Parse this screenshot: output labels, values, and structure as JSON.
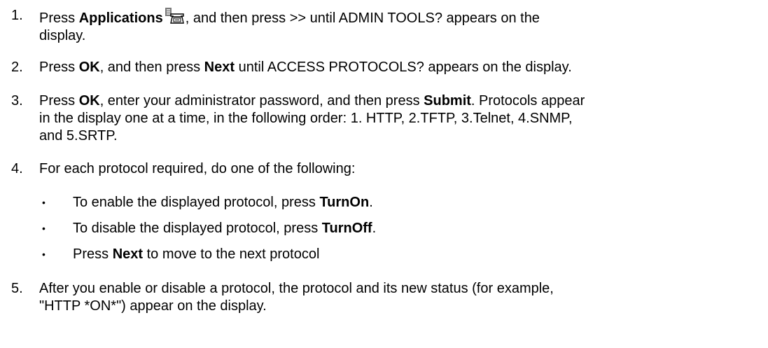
{
  "steps": [
    {
      "num": "1.",
      "pre": "Press ",
      "b1": "Applications",
      "mid": ", and then press >> until ADMIN TOOLS? appears on the",
      "line2": "display.",
      "icon": "applications-icon"
    },
    {
      "num": "2.",
      "pre": "Press ",
      "b1": "OK",
      "mid": ", and then press ",
      "b2": "Next",
      "post": " until ACCESS PROTOCOLS? appears on the display."
    },
    {
      "num": "3.",
      "pre": "Press ",
      "b1": "OK",
      "mid": ", enter your administrator password, and then press ",
      "b2": "Submit",
      "post": ". Protocols appear",
      "line2": "in the display one at a time, in the following order:  1. HTTP, 2.TFTP, 3.Telnet, 4.SNMP,",
      "line3": "and 5.SRTP."
    },
    {
      "num": "4.",
      "text": "For each protocol required, do one of the following:"
    },
    {
      "num": "5.",
      "line1": "After you enable or disable a protocol, the protocol and its new status (for example,",
      "line2": "\"HTTP *ON*\") appear on the display."
    }
  ],
  "bullets": [
    {
      "pre": "To enable the displayed protocol, press ",
      "bold": "TurnOn",
      "post": "."
    },
    {
      "pre": "To disable the displayed protocol, press ",
      "bold": "TurnOff",
      "post": "."
    },
    {
      "pre": "Press ",
      "bold": "Next",
      "post": " to move to the next protocol"
    }
  ],
  "bullet_glyph": "•"
}
